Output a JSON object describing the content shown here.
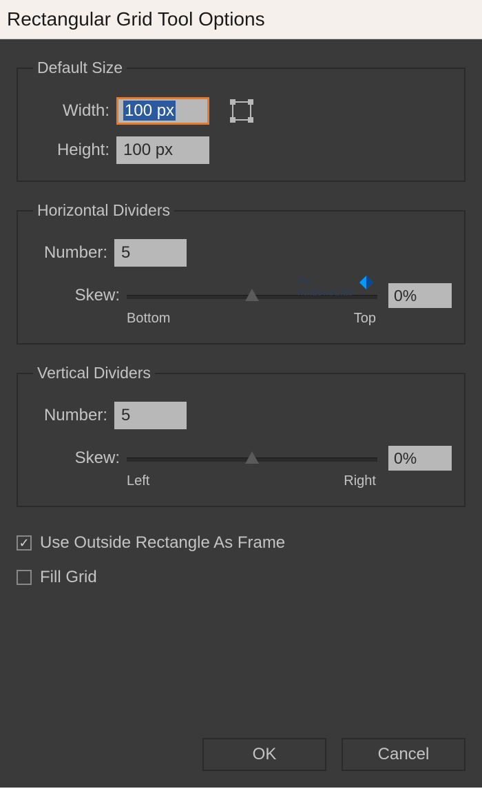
{
  "title": "Rectangular Grid Tool Options",
  "defaultSize": {
    "legend": "Default Size",
    "widthLabel": "Width:",
    "widthValue": "100 px",
    "heightLabel": "Height:",
    "heightValue": "100 px"
  },
  "horizontalDividers": {
    "legend": "Horizontal Dividers",
    "numberLabel": "Number:",
    "numberValue": "5",
    "skewLabel": "Skew:",
    "skewValue": "0%",
    "minLabel": "Bottom",
    "maxLabel": "Top"
  },
  "verticalDividers": {
    "legend": "Vertical Dividers",
    "numberLabel": "Number:",
    "numberValue": "5",
    "skewLabel": "Skew:",
    "skewValue": "0%",
    "minLabel": "Left",
    "maxLabel": "Right"
  },
  "useOutsideFrameLabel": "Use Outside Rectangle As Frame",
  "useOutsideFrameChecked": true,
  "fillGridLabel": "Fill Grid",
  "fillGridChecked": false,
  "okLabel": "OK",
  "cancelLabel": "Cancel",
  "watermark": "The\nWindowsClub"
}
